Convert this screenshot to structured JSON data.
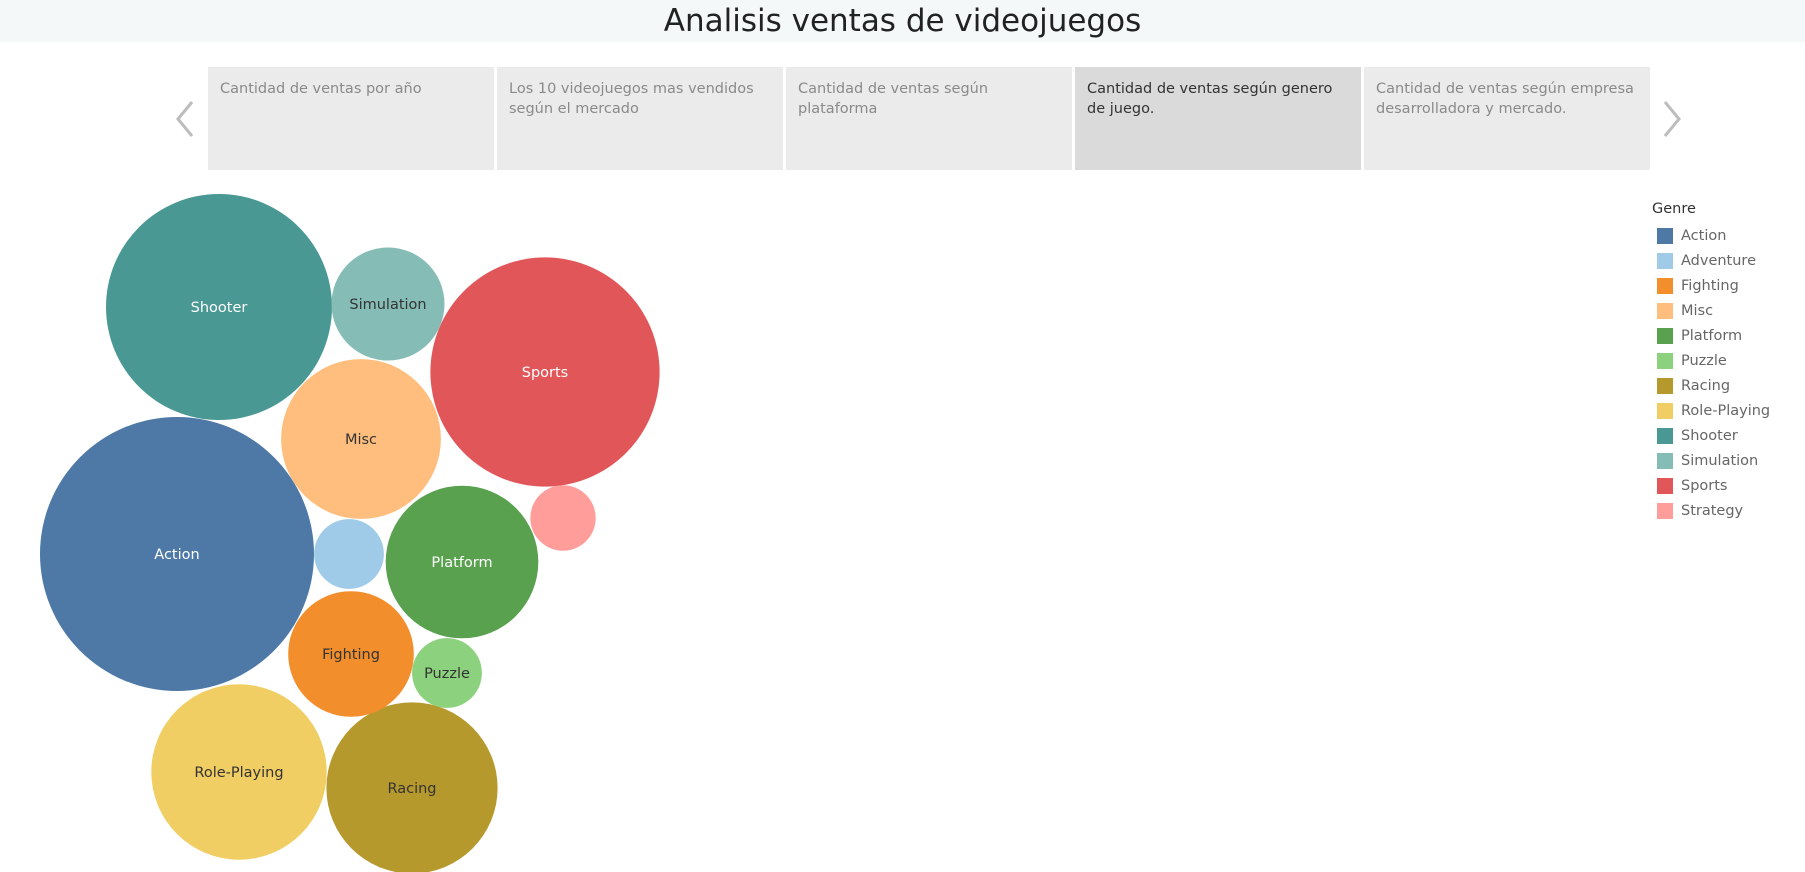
{
  "header": {
    "title": "Analisis ventas de videojuegos"
  },
  "story": {
    "points": [
      {
        "label": "Cantidad de ventas por año",
        "active": false
      },
      {
        "label": "Los 10 videojuegos mas vendidos según el mercado",
        "active": false
      },
      {
        "label": "Cantidad de ventas según plataforma",
        "active": false
      },
      {
        "label": "Cantidad de ventas según genero de juego.",
        "active": true
      },
      {
        "label": "Cantidad de ventas según empresa desarrolladora y mercado.",
        "active": false
      }
    ],
    "prev_icon": "chevron-left-icon",
    "next_icon": "chevron-right-icon"
  },
  "legend": {
    "title": "Genre",
    "items": [
      {
        "label": "Action",
        "color": "#4e79a7"
      },
      {
        "label": "Adventure",
        "color": "#a0cbe8"
      },
      {
        "label": "Fighting",
        "color": "#f28e2b"
      },
      {
        "label": "Misc",
        "color": "#ffbe7d"
      },
      {
        "label": "Platform",
        "color": "#59a14f"
      },
      {
        "label": "Puzzle",
        "color": "#8cd17d"
      },
      {
        "label": "Racing",
        "color": "#b6992d"
      },
      {
        "label": "Role-Playing",
        "color": "#f1ce63"
      },
      {
        "label": "Shooter",
        "color": "#499894"
      },
      {
        "label": "Simulation",
        "color": "#86bcb6"
      },
      {
        "label": "Sports",
        "color": "#e15759"
      },
      {
        "label": "Strategy",
        "color": "#ff9d9a"
      }
    ]
  },
  "chart_data": {
    "type": "packed-bubble",
    "measure": "relative sales (area-proportional, estimated)",
    "bubbles": [
      {
        "genre": "Action",
        "value": 1.0,
        "color": "#4e79a7",
        "label": "Action",
        "label_color": "#ffffff"
      },
      {
        "genre": "Shooter",
        "value": 0.68,
        "color": "#499894",
        "label": "Shooter",
        "label_color": "#ffffff"
      },
      {
        "genre": "Sports",
        "value": 0.7,
        "color": "#e15759",
        "label": "Sports",
        "label_color": "#ffffff"
      },
      {
        "genre": "Role-Playing",
        "value": 0.41,
        "color": "#f1ce63",
        "label": "Role-Playing",
        "label_color": "#333333"
      },
      {
        "genre": "Racing",
        "value": 0.39,
        "color": "#b6992d",
        "label": "Racing",
        "label_color": "#333333"
      },
      {
        "genre": "Platform",
        "value": 0.31,
        "color": "#59a14f",
        "label": "Platform",
        "label_color": "#ffffff"
      },
      {
        "genre": "Misc",
        "value": 0.34,
        "color": "#ffbe7d",
        "label": "Misc",
        "label_color": "#333333"
      },
      {
        "genre": "Fighting",
        "value": 0.21,
        "color": "#f28e2b",
        "label": "Fighting",
        "label_color": "#333333"
      },
      {
        "genre": "Simulation",
        "value": 0.17,
        "color": "#86bcb6",
        "label": "Simulation",
        "label_color": "#333333"
      },
      {
        "genre": "Puzzle",
        "value": 0.065,
        "color": "#8cd17d",
        "label": "Puzzle",
        "label_color": "#333333"
      },
      {
        "genre": "Adventure",
        "value": 0.065,
        "color": "#a0cbe8",
        "label": "",
        "label_color": "#333333"
      },
      {
        "genre": "Strategy",
        "value": 0.057,
        "color": "#ff9d9a",
        "label": "",
        "label_color": "#333333"
      }
    ]
  }
}
